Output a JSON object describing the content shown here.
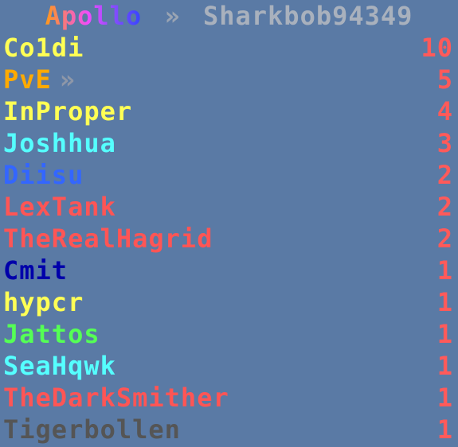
{
  "header": {
    "server": "Apollo",
    "separator": "»",
    "player": "Sharkbob94349"
  },
  "colors": {
    "background": "#5a7aa5",
    "score": "#ff5a5a",
    "yellow": "#ffff55",
    "gold": "#ffaa00",
    "aqua": "#55ffff",
    "blue": "#3366ff",
    "red": "#ff5555",
    "dark_blue": "#0000aa",
    "green": "#55ff55",
    "dark_gray": "#555555"
  },
  "rows": [
    {
      "name": "Co1di",
      "suffix": "",
      "score": "10",
      "color": "#ffff55"
    },
    {
      "name": "PvE",
      "suffix": "»",
      "score": "5",
      "color": "#ffaa00"
    },
    {
      "name": "InProper",
      "suffix": "",
      "score": "4",
      "color": "#ffff55"
    },
    {
      "name": "Joshhua",
      "suffix": "",
      "score": "3",
      "color": "#55ffff"
    },
    {
      "name": "Diisu",
      "suffix": "",
      "score": "2",
      "color": "#3366ff"
    },
    {
      "name": "LexTank",
      "suffix": "",
      "score": "2",
      "color": "#ff5555"
    },
    {
      "name": "TheRealHagrid",
      "suffix": "",
      "score": "2",
      "color": "#ff5555"
    },
    {
      "name": "Cmit",
      "suffix": "",
      "score": "1",
      "color": "#0000aa"
    },
    {
      "name": "hypcr",
      "suffix": "",
      "score": "1",
      "color": "#ffff55"
    },
    {
      "name": "Jattos",
      "suffix": "",
      "score": "1",
      "color": "#55ff55"
    },
    {
      "name": "SeaHqwk",
      "suffix": "",
      "score": "1",
      "color": "#55ffff"
    },
    {
      "name": "TheDarkSmither",
      "suffix": "",
      "score": "1",
      "color": "#ff5555"
    },
    {
      "name": "Tigerbollen",
      "suffix": "",
      "score": "1",
      "color": "#555555"
    }
  ]
}
